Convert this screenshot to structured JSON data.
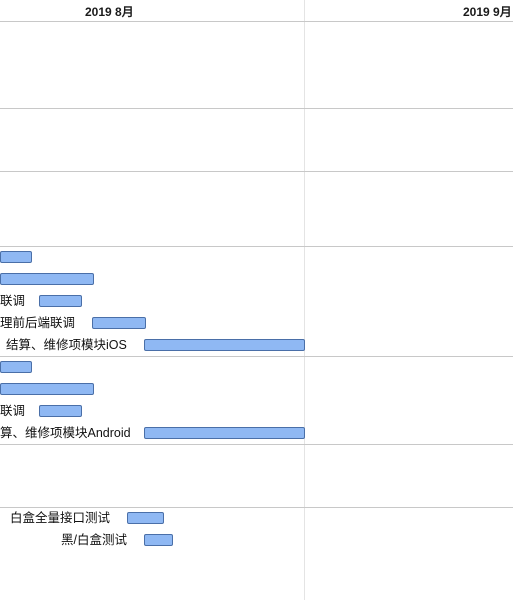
{
  "timeline": {
    "months": [
      {
        "label": "2019 8月"
      },
      {
        "label": "2019 9月"
      }
    ]
  },
  "tasks": [
    {
      "label": ""
    },
    {
      "label": ""
    },
    {
      "label": "联调"
    },
    {
      "label": "理前后端联调"
    },
    {
      "label": "结算、维修项模块iOS"
    },
    {
      "label": ""
    },
    {
      "label": ""
    },
    {
      "label": "联调"
    },
    {
      "label": "算、维修项模块Android"
    },
    {
      "label": "白盒全量接口测试"
    },
    {
      "label": "黑/白盒测试"
    }
  ]
}
